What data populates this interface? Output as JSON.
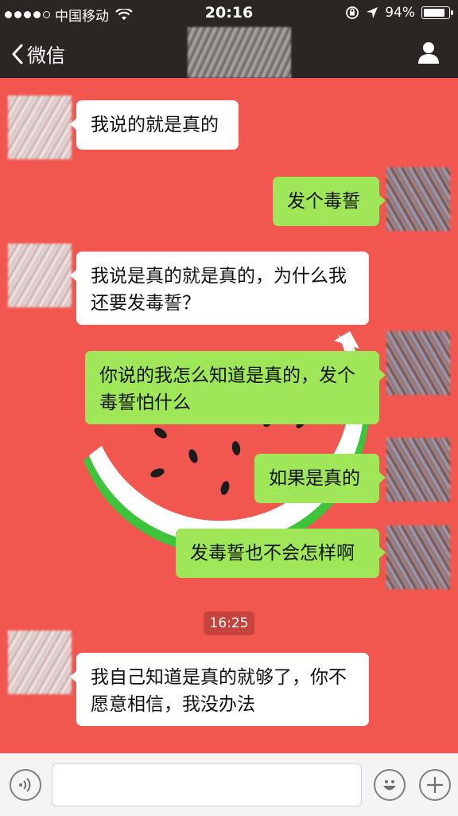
{
  "status_bar": {
    "carrier": "中国移动",
    "time": "20:16",
    "battery_text": "94%",
    "battery_level": 0.94
  },
  "nav": {
    "back_label": "微信"
  },
  "messages": [
    {
      "side": "in",
      "text": "我说的就是真的"
    },
    {
      "side": "out",
      "text": "发个毒誓"
    },
    {
      "side": "in",
      "text": "我说是真的就是真的，为什么我还要发毒誓？"
    },
    {
      "side": "out",
      "text": "你说的我怎么知道是真的，发个毒誓怕什么"
    },
    {
      "side": "out",
      "text": "如果是真的"
    },
    {
      "side": "out",
      "text": "发毒誓也不会怎样啊"
    },
    {
      "side": "in",
      "text": "我自己知道是真的就够了，你不愿意相信，我没办法"
    }
  ],
  "timestamp": "16:25",
  "input": {
    "placeholder": ""
  },
  "colors": {
    "chat_background": "#f2574f",
    "incoming_bubble": "#ffffff",
    "outgoing_bubble": "#9fe658",
    "bar_background": "#2b2624"
  },
  "icons": [
    "back-chevron-icon",
    "profile-icon",
    "voice-icon",
    "emoji-icon",
    "plus-icon",
    "wifi-icon",
    "location-arrow-icon",
    "rotation-lock-icon"
  ]
}
